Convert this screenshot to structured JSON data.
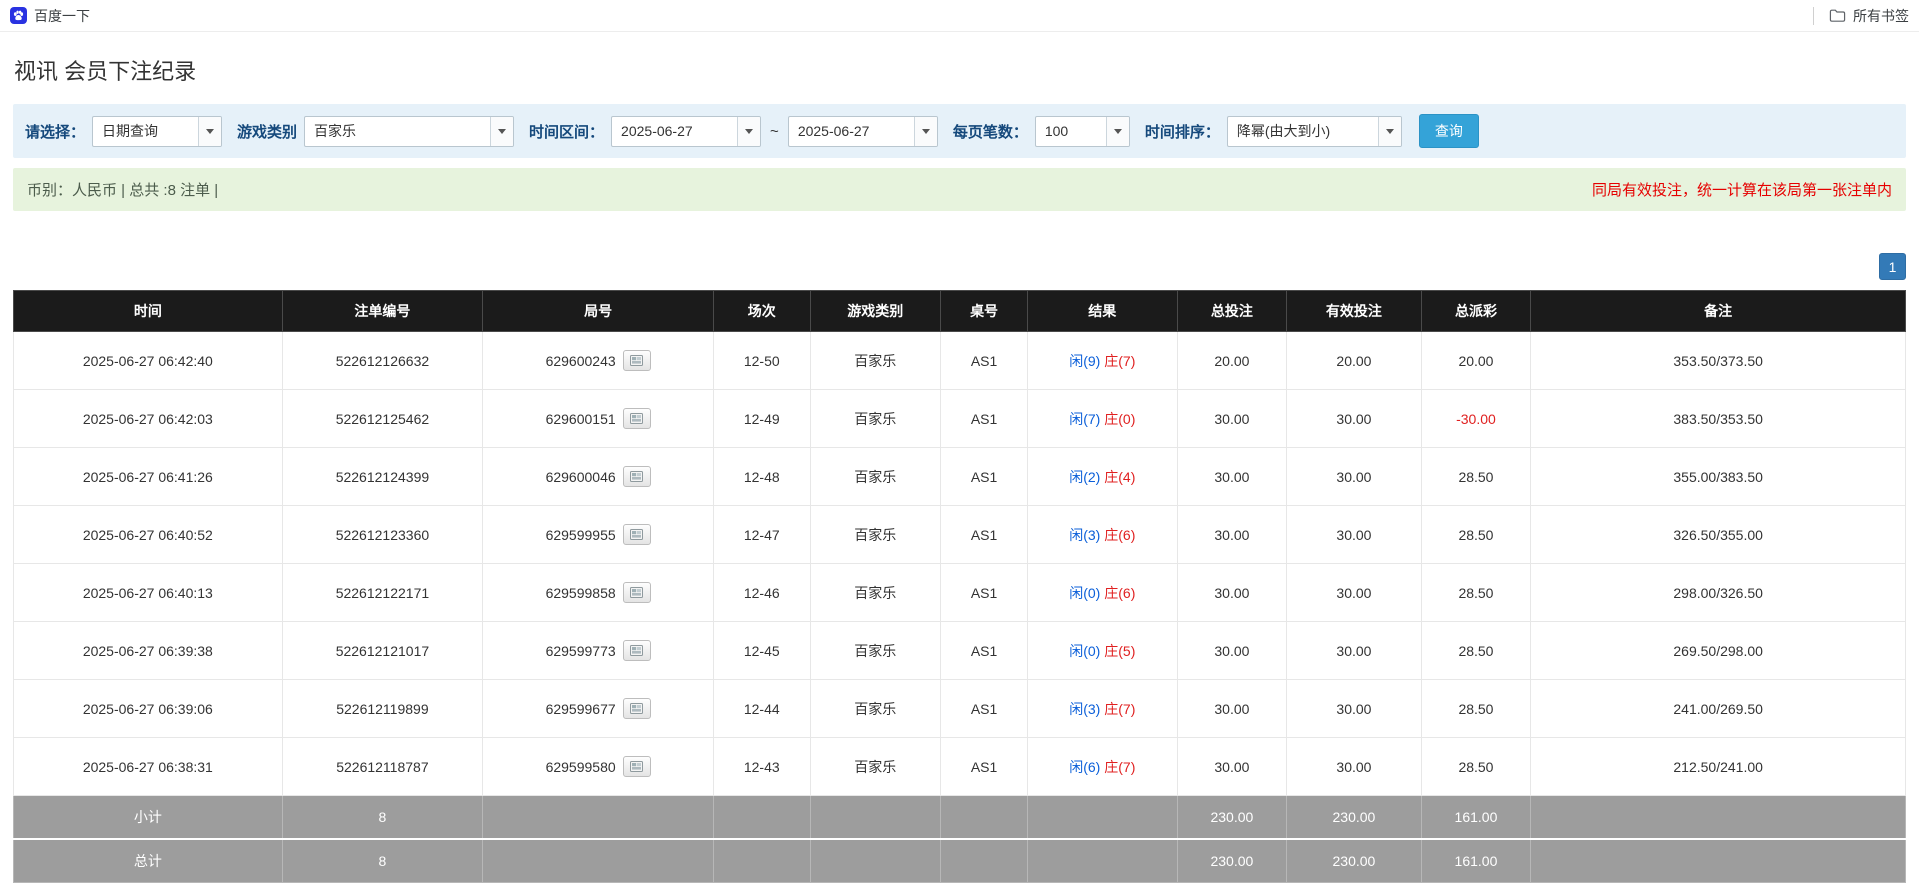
{
  "bookmarks_bar": {
    "bookmark_label": "百度一下",
    "all_bookmarks_label": "所有书签"
  },
  "page": {
    "title": "视讯 会员下注纪录"
  },
  "filters": {
    "select_label": "请选择：",
    "select_value": "日期查询",
    "game_type_label": "游戏类别",
    "game_type_value": "百家乐",
    "date_range_label": "时间区间：",
    "date_from": "2025-06-27",
    "date_separator": "~",
    "date_to": "2025-06-27",
    "page_size_label": "每页笔数：",
    "page_size_value": "100",
    "sort_label": "时间排序：",
    "sort_value": "降幂(由大到小)",
    "search_button_label": "查询"
  },
  "summary": {
    "left_text": "币别：人民币 | 总共 :8 注单 |",
    "right_text": "同局有效投注，统一计算在该局第一张注单内"
  },
  "pagination": {
    "current_page": "1"
  },
  "icons": {
    "favicon": "baidu-paw-icon",
    "folder": "folder-icon",
    "dropdown": "chevron-down-icon",
    "round_video": "video-replay-icon"
  },
  "colors": {
    "accent_blue": "#34a3d8",
    "pagination_blue": "#337ab7",
    "link_blue": "#1570c8",
    "player_blue": "#0b5fd9",
    "banker_red": "#e02020",
    "negative_red": "#e02020",
    "header_black": "#1b1b1b",
    "footer_gray": "#9d9d9d",
    "filter_bg": "#e6f1f9",
    "summary_bg": "#e7f3dd"
  },
  "table": {
    "headers": [
      "时间",
      "注单编号",
      "局号",
      "场次",
      "游戏类别",
      "桌号",
      "结果",
      "总投注",
      "有效投注",
      "总派彩",
      "备注"
    ],
    "rows": [
      {
        "time": "2025-06-27 06:42:40",
        "bet_id": "522612126632",
        "round_id": "629600243",
        "session": "12-50",
        "game": "百家乐",
        "table_no": "AS1",
        "result_player": "闲(9)",
        "result_banker": "庄(7)",
        "total_bet": "20.00",
        "valid_bet": "20.00",
        "payout": "20.00",
        "note": "353.50/373.50"
      },
      {
        "time": "2025-06-27 06:42:03",
        "bet_id": "522612125462",
        "round_id": "629600151",
        "session": "12-49",
        "game": "百家乐",
        "table_no": "AS1",
        "result_player": "闲(7)",
        "result_banker": "庄(0)",
        "total_bet": "30.00",
        "valid_bet": "30.00",
        "payout": "-30.00",
        "note": "383.50/353.50"
      },
      {
        "time": "2025-06-27 06:41:26",
        "bet_id": "522612124399",
        "round_id": "629600046",
        "session": "12-48",
        "game": "百家乐",
        "table_no": "AS1",
        "result_player": "闲(2)",
        "result_banker": "庄(4)",
        "total_bet": "30.00",
        "valid_bet": "30.00",
        "payout": "28.50",
        "note": "355.00/383.50"
      },
      {
        "time": "2025-06-27 06:40:52",
        "bet_id": "522612123360",
        "round_id": "629599955",
        "session": "12-47",
        "game": "百家乐",
        "table_no": "AS1",
        "result_player": "闲(3)",
        "result_banker": "庄(6)",
        "total_bet": "30.00",
        "valid_bet": "30.00",
        "payout": "28.50",
        "note": "326.50/355.00"
      },
      {
        "time": "2025-06-27 06:40:13",
        "bet_id": "522612122171",
        "round_id": "629599858",
        "session": "12-46",
        "game": "百家乐",
        "table_no": "AS1",
        "result_player": "闲(0)",
        "result_banker": "庄(6)",
        "total_bet": "30.00",
        "valid_bet": "30.00",
        "payout": "28.50",
        "note": "298.00/326.50"
      },
      {
        "time": "2025-06-27 06:39:38",
        "bet_id": "522612121017",
        "round_id": "629599773",
        "session": "12-45",
        "game": "百家乐",
        "table_no": "AS1",
        "result_player": "闲(0)",
        "result_banker": "庄(5)",
        "total_bet": "30.00",
        "valid_bet": "30.00",
        "payout": "28.50",
        "note": "269.50/298.00"
      },
      {
        "time": "2025-06-27 06:39:06",
        "bet_id": "522612119899",
        "round_id": "629599677",
        "session": "12-44",
        "game": "百家乐",
        "table_no": "AS1",
        "result_player": "闲(3)",
        "result_banker": "庄(7)",
        "total_bet": "30.00",
        "valid_bet": "30.00",
        "payout": "28.50",
        "note": "241.00/269.50"
      },
      {
        "time": "2025-06-27 06:38:31",
        "bet_id": "522612118787",
        "round_id": "629599580",
        "session": "12-43",
        "game": "百家乐",
        "table_no": "AS1",
        "result_player": "闲(6)",
        "result_banker": "庄(7)",
        "total_bet": "30.00",
        "valid_bet": "30.00",
        "payout": "28.50",
        "note": "212.50/241.00"
      }
    ],
    "subtotal": {
      "label": "小计",
      "count": "8",
      "total_bet": "230.00",
      "valid_bet": "230.00",
      "payout": "161.00"
    },
    "total": {
      "label": "总计",
      "count": "8",
      "total_bet": "230.00",
      "valid_bet": "230.00",
      "payout": "161.00"
    }
  }
}
